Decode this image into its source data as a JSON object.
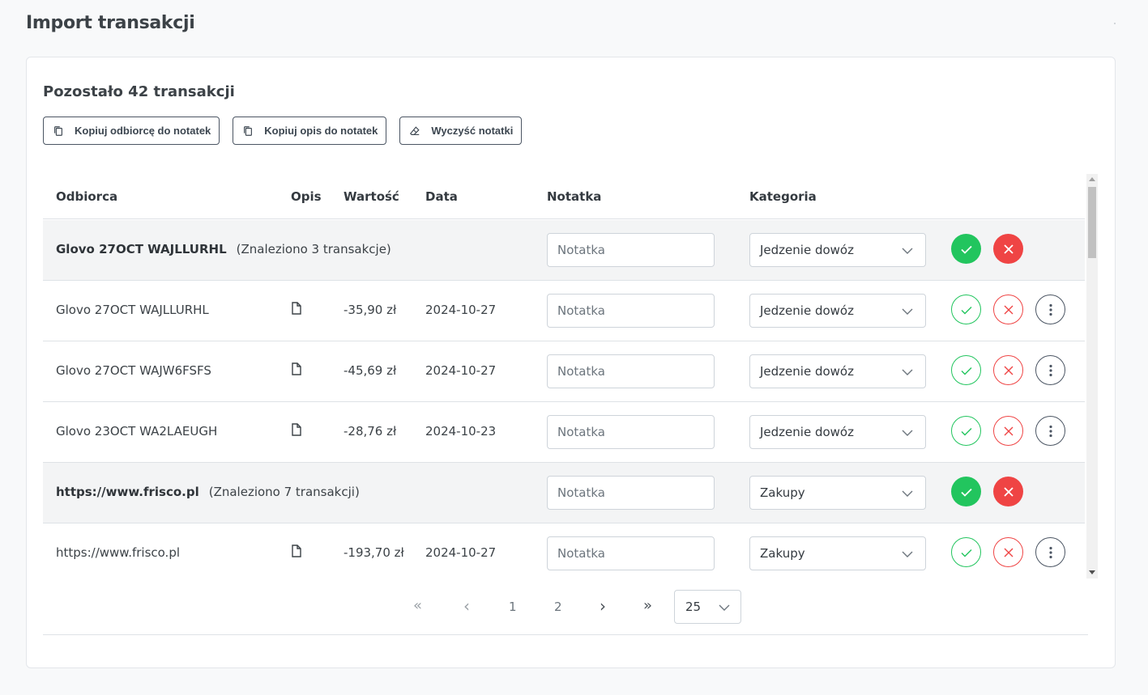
{
  "page": {
    "title": "Import transakcji"
  },
  "summary": {
    "remaining": "Pozostało 42 transakcji"
  },
  "toolbar": {
    "copy_recipient": "Kopiuj odbiorcę do notatek",
    "copy_description": "Kopiuj opis do notatek",
    "clear_notes": "Wyczyść notatki"
  },
  "table": {
    "headers": {
      "recipient": "Odbiorca",
      "description": "Opis",
      "value": "Wartość",
      "date": "Data",
      "note": "Notatka",
      "category": "Kategoria"
    },
    "rows": [
      {
        "type": "group",
        "name": "Glovo 27OCT WAJLLURHL",
        "found": "(Znaleziono 3 transakcje)",
        "note_placeholder": "Notatka",
        "category": "Jedzenie dowóz"
      },
      {
        "type": "item",
        "name": "Glovo 27OCT WAJLLURHL",
        "value": "-35,90 zł",
        "date": "2024-10-27",
        "note_placeholder": "Notatka",
        "category": "Jedzenie dowóz"
      },
      {
        "type": "item",
        "name": "Glovo 27OCT WAJW6FSFS",
        "value": "-45,69 zł",
        "date": "2024-10-27",
        "note_placeholder": "Notatka",
        "category": "Jedzenie dowóz"
      },
      {
        "type": "item",
        "name": "Glovo 23OCT WA2LAEUGH",
        "value": "-28,76 zł",
        "date": "2024-10-23",
        "note_placeholder": "Notatka",
        "category": "Jedzenie dowóz"
      },
      {
        "type": "group",
        "name": "https://www.frisco.pl",
        "found": "(Znaleziono 7 transakcji)",
        "note_placeholder": "Notatka",
        "category": "Zakupy"
      },
      {
        "type": "item",
        "name": "https://www.frisco.pl",
        "value": "-193,70 zł",
        "date": "2024-10-27",
        "note_placeholder": "Notatka",
        "category": "Zakupy"
      }
    ]
  },
  "pagination": {
    "first": "«",
    "prev": "‹",
    "pages": [
      "1",
      "2"
    ],
    "next": "›",
    "last": "»",
    "page_size": "25"
  },
  "colors": {
    "accept": "#22c55e",
    "reject": "#ef4444",
    "outline_dark": "#4b5563"
  },
  "icons": {
    "copy": "copy-icon",
    "eraser": "eraser-icon",
    "document": "document-icon",
    "check": "check-icon",
    "close": "close-icon",
    "more": "more-vertical-icon",
    "chevron": "chevron-down-icon"
  }
}
